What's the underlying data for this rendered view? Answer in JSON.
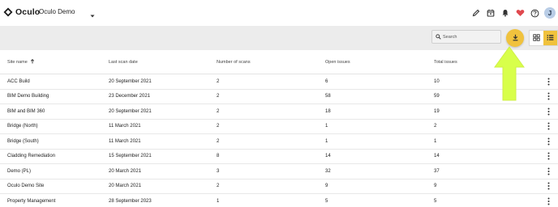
{
  "app": {
    "logo_text": "Oculo",
    "project_name": "Oculo Demo",
    "user_initial": "J",
    "accent_color": "#f0c23d",
    "annotation_color": "#d8ff4a"
  },
  "topbar": {
    "icons": [
      "pencil-icon",
      "calendar-icon",
      "bell-icon",
      "heart-icon",
      "help-icon"
    ]
  },
  "toolbar": {
    "search_placeholder": "Search",
    "download_icon": "download-icon",
    "views": [
      "grid-view-icon",
      "list-view-icon"
    ],
    "active_view": "list-view-icon"
  },
  "table": {
    "columns": [
      "Site name",
      "Last scan date",
      "Number of scans",
      "Open issues",
      "Total issues"
    ],
    "sorted_column": "Site name",
    "sort_direction": "ascending",
    "rows": [
      {
        "site": "ACC Build",
        "date": "20 September 2021",
        "scans": "2",
        "open": "6",
        "total": "10"
      },
      {
        "site": "BIM Demo Building",
        "date": "23 December 2021",
        "scans": "2",
        "open": "58",
        "total": "59"
      },
      {
        "site": "BIM and BIM 360",
        "date": "20 September 2021",
        "scans": "2",
        "open": "18",
        "total": "19"
      },
      {
        "site": "Bridge (North)",
        "date": "11 March 2021",
        "scans": "2",
        "open": "1",
        "total": "2"
      },
      {
        "site": "Bridge (South)",
        "date": "11 March 2021",
        "scans": "2",
        "open": "1",
        "total": "1"
      },
      {
        "site": "Cladding Remediation",
        "date": "15 September 2021",
        "scans": "8",
        "open": "14",
        "total": "14"
      },
      {
        "site": "Demo (PL)",
        "date": "20 March 2021",
        "scans": "3",
        "open": "32",
        "total": "37"
      },
      {
        "site": "Oculo Demo Site",
        "date": "20 March 2021",
        "scans": "2",
        "open": "9",
        "total": "9"
      },
      {
        "site": "Property Management",
        "date": "28 September 2023",
        "scans": "1",
        "open": "5",
        "total": "5"
      }
    ]
  }
}
